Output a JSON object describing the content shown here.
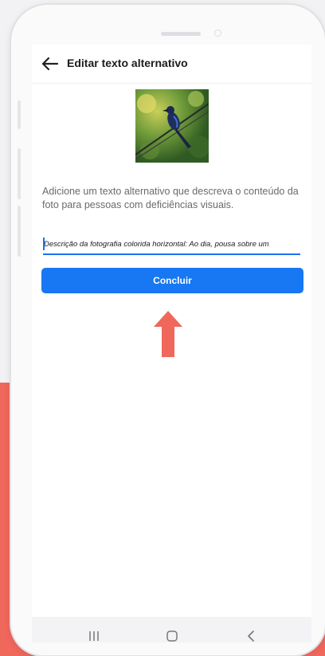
{
  "app_bar": {
    "title": "Editar texto alternativo",
    "back_icon": "arrow-left-icon"
  },
  "photo": {
    "alt": "Pássaro azul pousado num fio"
  },
  "description": "Adicione um texto alternativo que descreva o conteúdo da foto para pessoas com deficiências visuais.",
  "alt_text_field": {
    "value": "Descrição da fotografia colorida horizontal: Ao dia, pousa sobre um"
  },
  "done_button": {
    "label": "Concluir"
  },
  "nav_bar": {
    "items": [
      "recent-apps-icon",
      "home-icon",
      "back-icon"
    ]
  },
  "colors": {
    "accent": "#1877f2",
    "highlight_arrow": "#f0675c",
    "background_band": "#f0675c"
  }
}
